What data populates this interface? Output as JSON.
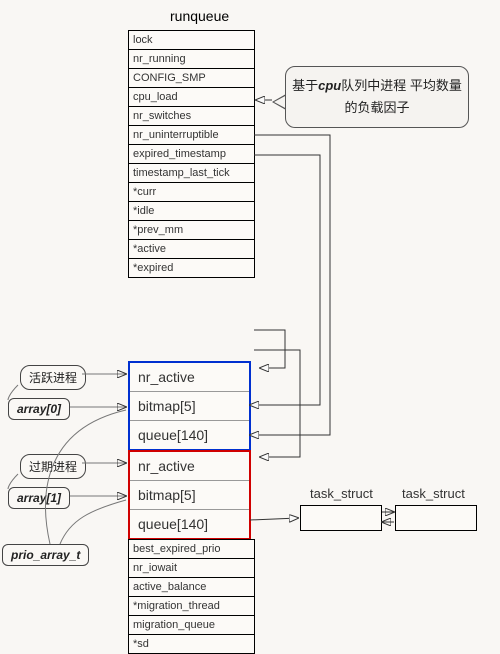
{
  "title": "runqueue",
  "tooltip": {
    "prefix": "基于",
    "bold1": "cpu",
    "mid": "队列中进程 平均数量的负载因子"
  },
  "struct_upper": [
    "lock",
    "nr_running",
    "CONFIG_SMP",
    "cpu_load",
    "nr_switches",
    "nr_uninterruptible",
    "expired_timestamp",
    "timestamp_last_tick",
    "*curr",
    "*idle",
    "*prev_mm",
    "*active",
    "*expired"
  ],
  "array_blue": [
    "nr_active",
    "bitmap[5]",
    "queue[140]"
  ],
  "array_red": [
    "nr_active",
    "bitmap[5]",
    "queue[140]"
  ],
  "struct_lower": [
    "best_expired_prio",
    "nr_iowait",
    "active_balance",
    "*migration_thread",
    "migration_queue",
    "*sd"
  ],
  "labels": {
    "active_proc": "活跃进程",
    "expired_proc": "过期进程",
    "array0": "array[0]",
    "array1": "array[1]",
    "prio_array_t": "prio_array_t",
    "task_struct": "task_struct"
  }
}
